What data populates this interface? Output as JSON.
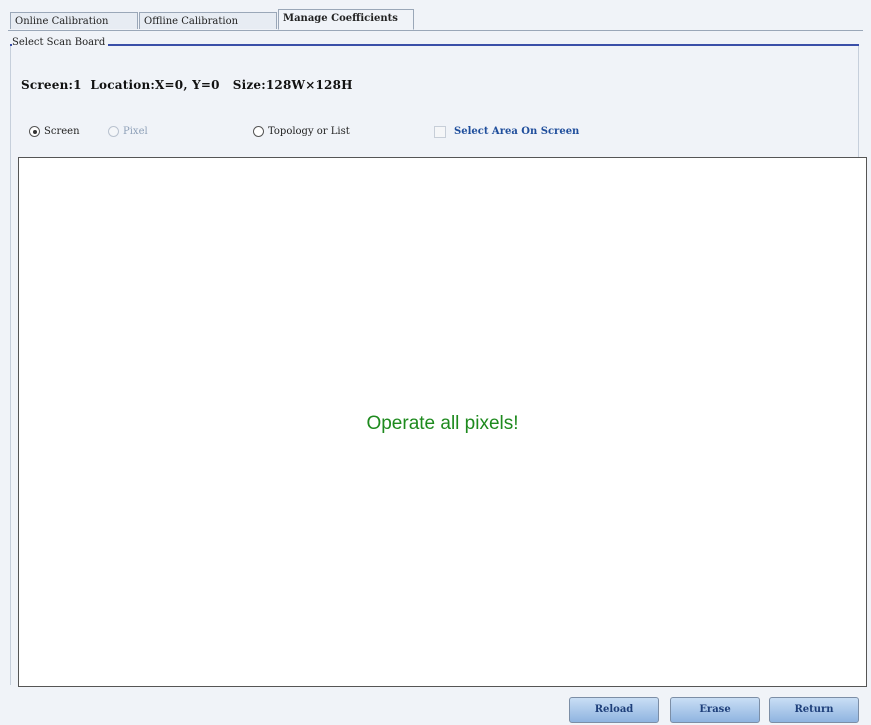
{
  "tabs": [
    {
      "label": "Online Calibration"
    },
    {
      "label": "Offline Calibration"
    },
    {
      "label": "Manage Coefficients"
    }
  ],
  "group": {
    "legend": "Select Scan Board"
  },
  "info": {
    "text": "Screen:1  Location:X=0, Y=0   Size:128W×128H"
  },
  "options": {
    "screen_label": "Screen",
    "pixel_label": "Pixel",
    "topology_label": "Topology or List",
    "select_area_label": "Select Area On Screen",
    "selected": "Screen"
  },
  "canvas": {
    "message": "Operate all pixels!"
  },
  "buttons": {
    "reload": "Reload",
    "erase": "Erase",
    "return": "Return"
  },
  "colors": {
    "message_green": "#1e8a1e",
    "link_blue": "#1f4e9c",
    "accent_line": "#3a4fa8"
  }
}
